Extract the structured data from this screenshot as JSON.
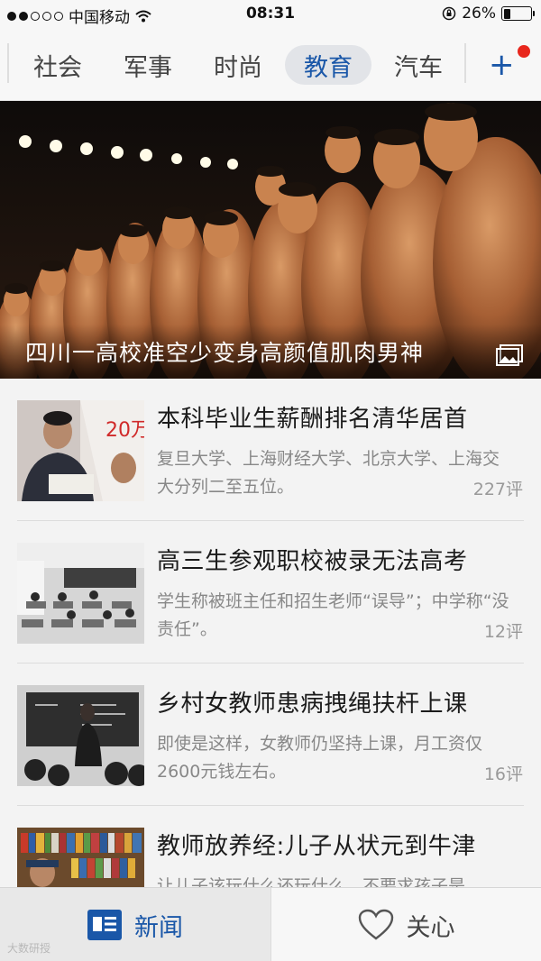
{
  "status_bar": {
    "carrier": "中国移动",
    "time": "08:31",
    "battery": "26%",
    "battery_level": 0.26
  },
  "tabs": [
    {
      "label": "社会",
      "active": false
    },
    {
      "label": "军事",
      "active": false
    },
    {
      "label": "时尚",
      "active": false
    },
    {
      "label": "教育",
      "active": true
    },
    {
      "label": "汽车",
      "active": false
    }
  ],
  "add_tab": {
    "icon": "plus-icon",
    "badge_color": "#e8271d"
  },
  "hero": {
    "title": "四川一高校准空少变身高颜值肌肉男神",
    "icon": "gallery-icon"
  },
  "news": [
    {
      "title": "本科毕业生薪酬排名清华居首",
      "summary": "复旦大学、上海财经大学、北京大学、上海交大分列二至五位。",
      "comments": "227评",
      "thumb_text": "20万"
    },
    {
      "title": "高三生参观职校被录无法高考",
      "summary": "学生称被班主任和招生老师“误导”；中学称“没责任”。",
      "comments": "12评"
    },
    {
      "title": "乡村女教师患病拽绳扶杆上课",
      "summary": "即使是这样，女教师仍坚持上课，月工资仅2600元钱左右。",
      "comments": "16评"
    },
    {
      "title": "教师放养经:儿子从状元到牛津",
      "summary": "让儿子该玩什么还玩什么，不要求孩子是",
      "comments": ""
    }
  ],
  "bottom_nav": {
    "news_label": "新闻",
    "care_label": "关心",
    "active_color": "#1a57a8"
  },
  "watermark": "大数研授"
}
